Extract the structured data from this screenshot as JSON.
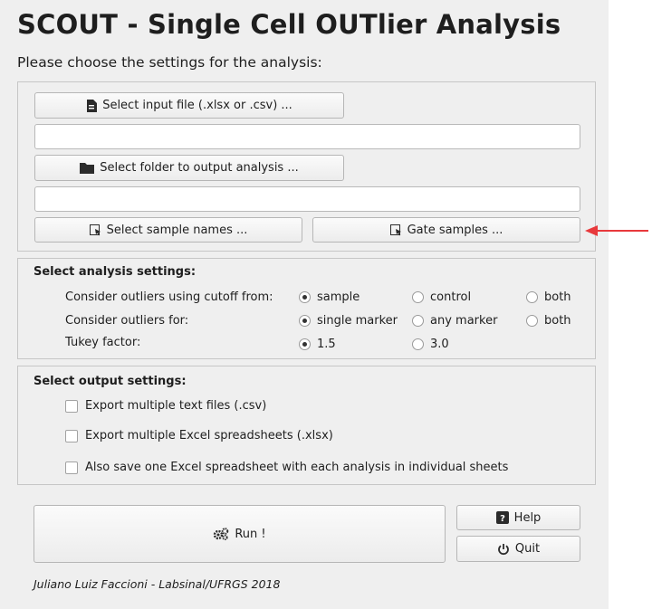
{
  "app": {
    "title": "SCOUT - Single Cell OUTlier Analysis",
    "subtitle": "Please choose the settings for the analysis:"
  },
  "files": {
    "select_input_label": "Select input file (.xlsx or .csv) ...",
    "input_path_value": "",
    "select_folder_label": "Select folder to output analysis ...",
    "output_path_value": "",
    "select_samples_label": "Select sample names ...",
    "gate_samples_label": "Gate samples ..."
  },
  "analysis": {
    "heading": "Select analysis settings:",
    "rows": [
      {
        "label": "Consider outliers using cutoff from:",
        "options": [
          "sample",
          "control",
          "both"
        ],
        "selected": "sample"
      },
      {
        "label": "Consider outliers for:",
        "options": [
          "single marker",
          "any marker",
          "both"
        ],
        "selected": "single marker"
      },
      {
        "label": "Tukey factor:",
        "options": [
          "1.5",
          "3.0"
        ],
        "selected": "1.5"
      }
    ]
  },
  "output": {
    "heading": "Select output settings:",
    "options": [
      {
        "label": "Export multiple text files (.csv)",
        "checked": false
      },
      {
        "label": "Export multiple Excel spreadsheets (.xlsx)",
        "checked": false
      },
      {
        "label": "Also save one Excel spreadsheet with each analysis in individual sheets",
        "checked": false
      }
    ]
  },
  "actions": {
    "run_label": "Run !",
    "help_label": "Help",
    "quit_label": "Quit"
  },
  "footer": {
    "credit": "Juliano Luiz Faccioni - Labsinal/UFRGS 2018"
  },
  "annotation": {
    "arrow_color": "#e8393c",
    "arrow_icon": "left-arrow-icon"
  }
}
